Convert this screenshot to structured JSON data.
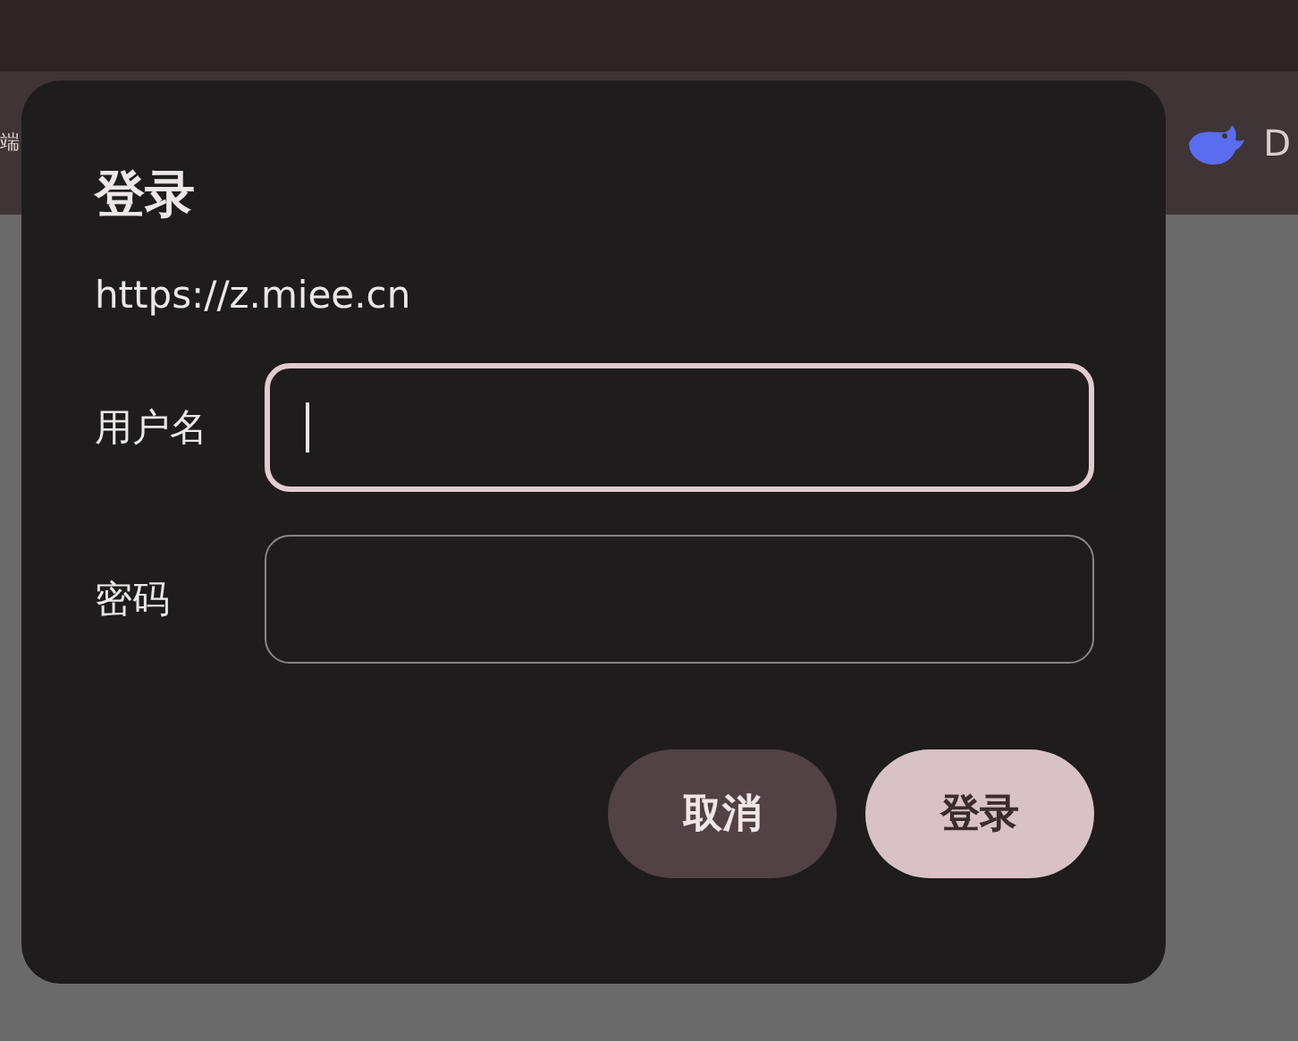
{
  "toolbar": {
    "left_text": "端",
    "right_text": "D"
  },
  "dialog": {
    "title": "登录",
    "url": "https://z.miee.cn",
    "fields": [
      {
        "label": "用户名",
        "focused": true
      },
      {
        "label": "密码",
        "focused": false
      }
    ],
    "buttons": [
      {
        "label": "取消",
        "kind": "secondary"
      },
      {
        "label": "登录",
        "kind": "primary"
      }
    ]
  }
}
